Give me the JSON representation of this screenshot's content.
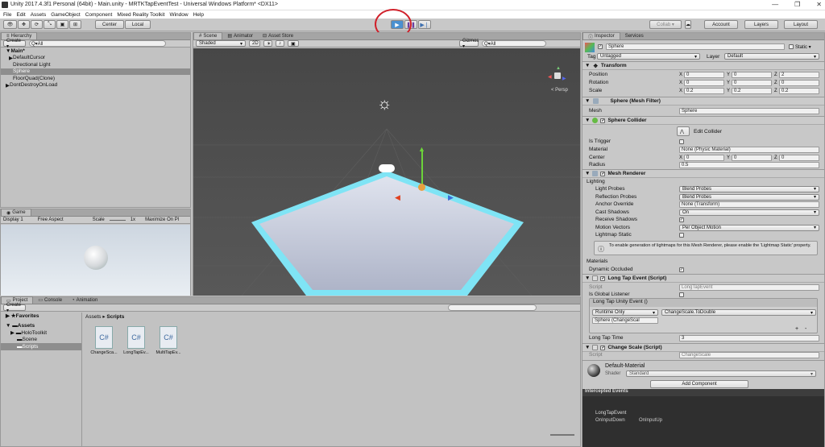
{
  "window": {
    "title": "Unity 2017.4.3f1 Personal (64bit) - Main.unity - MRTKTapEventTest - Universal Windows Platform* <DX11>"
  },
  "menu": [
    "File",
    "Edit",
    "Assets",
    "GameObject",
    "Component",
    "Mixed Reality Toolkit",
    "Window",
    "Help"
  ],
  "toolbar": {
    "center": "Center",
    "local": "Local",
    "collab": "Collab ▾",
    "account": "Account",
    "layers": "Layers",
    "layout": "Layout"
  },
  "hierarchy": {
    "tab": "Hierarchy",
    "create": "Create ▾",
    "search_placeholder": "Q▾All",
    "items": [
      "Main*",
      "DefaultCursor",
      "Directional Light",
      "Sphere",
      "FloorQuad(Clone)",
      "DontDestroyOnLoad"
    ]
  },
  "scene": {
    "tabs": [
      "Scene",
      "Animator",
      "Asset Store"
    ],
    "shaded": "Shaded",
    "mode2d": "2D",
    "gizmos": "Gizmos ▾",
    "search": "Q▾All",
    "persp": "< Persp"
  },
  "game": {
    "tab": "Game",
    "display": "Display 1",
    "aspect": "Free Aspect",
    "scale_label": "Scale",
    "scale_value": "1x",
    "maximize": "Maximize On Pl"
  },
  "project": {
    "tabs": [
      "Project",
      "Console",
      "Animation"
    ],
    "create": "Create ▾",
    "favorites": "Favorites",
    "assets": "Assets",
    "folders": [
      "HoloToolkit",
      "Scene",
      "Scripts"
    ],
    "breadcrumb": [
      "Assets",
      "Scripts"
    ],
    "files": [
      "ChangeSca...",
      "LongTapEv...",
      "MultiTapEv..."
    ],
    "file_icon": "C#"
  },
  "inspector": {
    "tabs": [
      "Inspector",
      "Services"
    ],
    "object_name": "Sphere",
    "static_label": "Static ▾",
    "tag_label": "Tag",
    "tag_value": "Untagged",
    "layer_label": "Layer",
    "layer_value": "Default",
    "transform": {
      "title": "Transform",
      "position": {
        "label": "Position",
        "x": "0",
        "y": "0",
        "z": "2"
      },
      "rotation": {
        "label": "Rotation",
        "x": "0",
        "y": "0",
        "z": "0"
      },
      "scale": {
        "label": "Scale",
        "x": "0.2",
        "y": "0.2",
        "z": "0.2"
      }
    },
    "mesh_filter": {
      "title": "Sphere (Mesh Filter)",
      "mesh_label": "Mesh",
      "mesh_value": "Sphere"
    },
    "collider": {
      "title": "Sphere Collider",
      "edit": "Edit Collider",
      "is_trigger": "Is Trigger",
      "material_label": "Material",
      "material_value": "None (Physic Material)",
      "center_label": "Center",
      "cx": "0",
      "cy": "0",
      "cz": "0",
      "radius_label": "Radius",
      "radius_value": "0.5"
    },
    "renderer": {
      "title": "Mesh Renderer",
      "lighting": "Lighting",
      "rows": [
        {
          "label": "Light Probes",
          "value": "Blend Probes"
        },
        {
          "label": "Reflection Probes",
          "value": "Blend Probes"
        },
        {
          "label": "Anchor Override",
          "value": "None (Transform)"
        },
        {
          "label": "Cast Shadows",
          "value": "On"
        },
        {
          "label": "Receive Shadows",
          "value": ""
        },
        {
          "label": "Motion Vectors",
          "value": "Per Object Motion"
        },
        {
          "label": "Lightmap Static",
          "value": ""
        }
      ],
      "info": "To enable generation of lightmaps for this Mesh Renderer, please enable the 'Lightmap Static' property.",
      "materials": "Materials",
      "dynamic_occluded": "Dynamic Occluded"
    },
    "long_tap": {
      "title": "Long Tap Event (Script)",
      "script_label": "Script",
      "script_value": "LongTapEvent",
      "global_label": "Is Global Listener",
      "event_title": "Long Tap Unity Event ()",
      "runtime": "Runtime Only",
      "func": "ChangeScale.ToDouble",
      "obj": "Sphere (ChangeScal",
      "plus": "+",
      "minus": "-",
      "time_label": "Long Tap Time",
      "time_value": "3"
    },
    "change_scale": {
      "title": "Change Scale (Script)",
      "script_label": "Script",
      "script_value": "ChangeScale"
    },
    "material": {
      "name": "Default-Material",
      "shader_label": "Shader",
      "shader_value": "Standard"
    },
    "add_component": "Add Component",
    "intercepted": {
      "title": "Intercepted Events",
      "event": "LongTapEvent",
      "handlers": [
        "OnInputDown",
        "OnInputUp"
      ]
    }
  }
}
